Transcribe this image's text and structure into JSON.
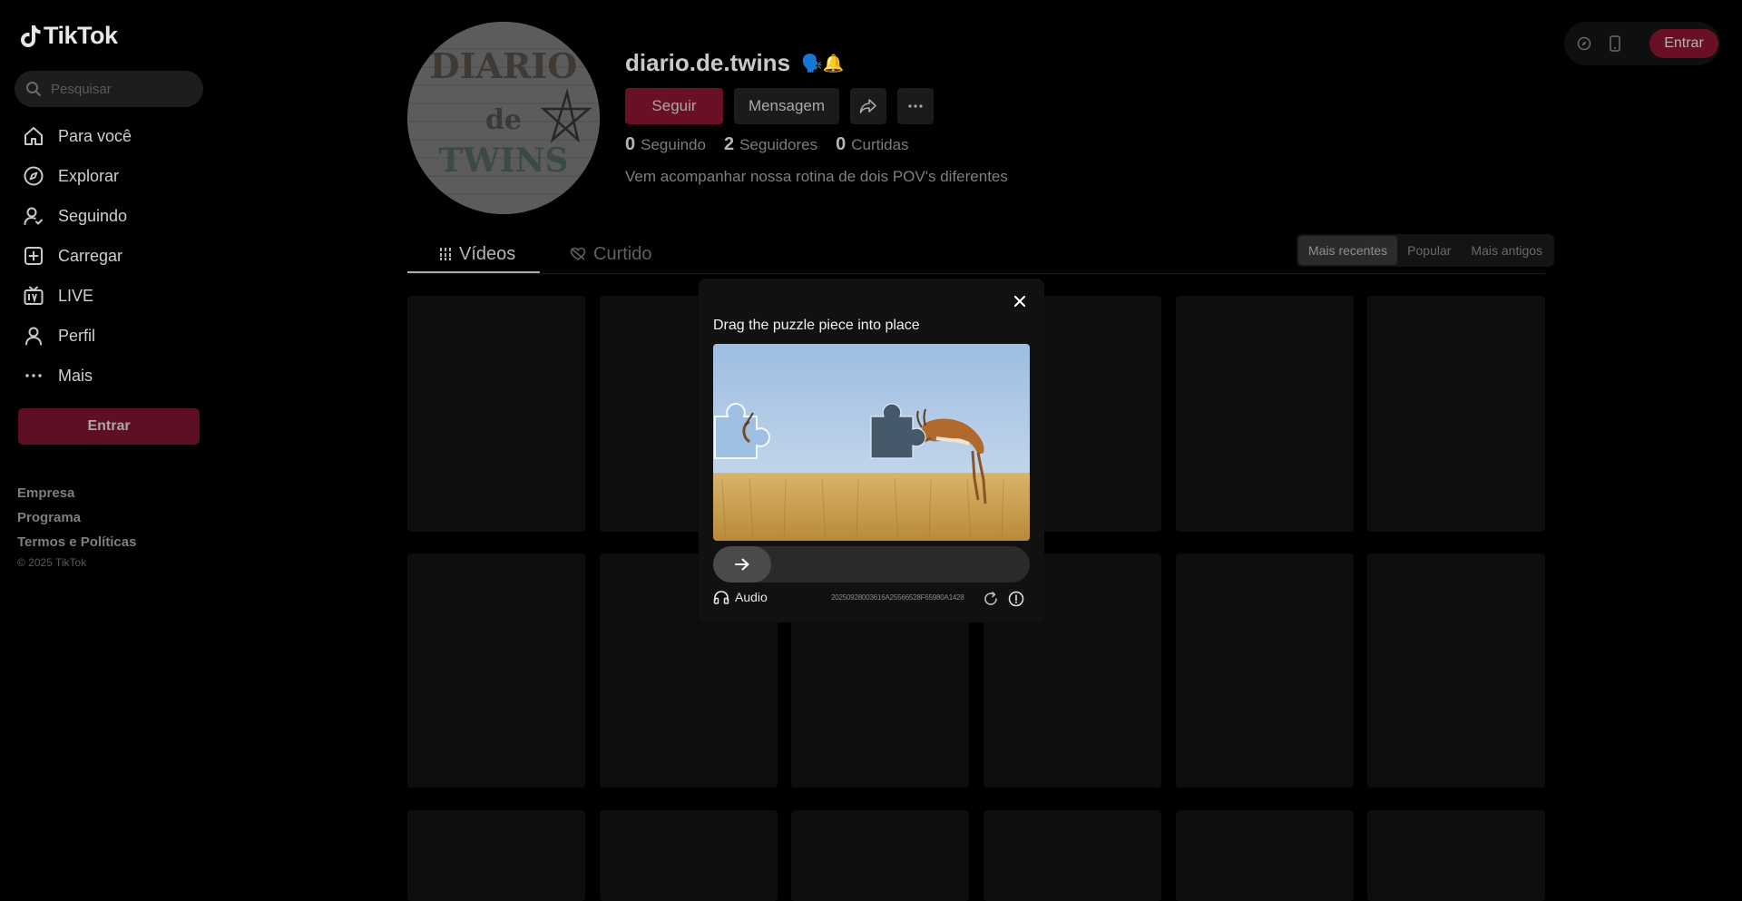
{
  "sidebar": {
    "logo_text": "TikTok",
    "search_placeholder": "Pesquisar",
    "items": [
      {
        "label": "Para você",
        "icon": "home-icon"
      },
      {
        "label": "Explorar",
        "icon": "compass-icon"
      },
      {
        "label": "Seguindo",
        "icon": "user-follow-icon"
      },
      {
        "label": "Carregar",
        "icon": "upload-icon"
      },
      {
        "label": "LIVE",
        "icon": "live-icon"
      },
      {
        "label": "Perfil",
        "icon": "profile-icon"
      },
      {
        "label": "Mais",
        "icon": "more-icon"
      }
    ],
    "enter_label": "Entrar",
    "footer_links": [
      "Empresa",
      "Programa",
      "Termos e Políticas"
    ],
    "copyright": "© 2025 TikTok"
  },
  "topbar": {
    "enter_label": "Entrar",
    "icons": [
      "compass-small-icon",
      "phone-icon"
    ]
  },
  "profile": {
    "username": "diario.de.twins",
    "username_emoji": "🗣️🔔",
    "follow_label": "Seguir",
    "message_label": "Mensagem",
    "stats": [
      {
        "value": "0",
        "label": "Seguindo"
      },
      {
        "value": "2",
        "label": "Seguidores"
      },
      {
        "value": "0",
        "label": "Curtidas"
      }
    ],
    "bio": "Vem acompanhar nossa rotina de dois POV's diferentes",
    "avatar_text": {
      "line1": "DIARIO",
      "line2": "de",
      "line3": "TWINS"
    }
  },
  "tabs": [
    {
      "label": "Vídeos",
      "icon": "grid-icon",
      "active": true
    },
    {
      "label": "Curtido",
      "icon": "heart-hidden-icon",
      "active": false
    }
  ],
  "sort": [
    {
      "label": "Mais recentes",
      "active": true
    },
    {
      "label": "Popular",
      "active": false
    },
    {
      "label": "Mais antigos",
      "active": false
    }
  ],
  "captcha": {
    "title": "Drag the puzzle piece into place",
    "audio_label": "Audio",
    "request_id": "20250928003616A25566528F65980A1428",
    "slider_progress": 0
  },
  "colors": {
    "background": "#000000",
    "brand_dim": "#6a1024",
    "modal_bg": "#111111"
  }
}
